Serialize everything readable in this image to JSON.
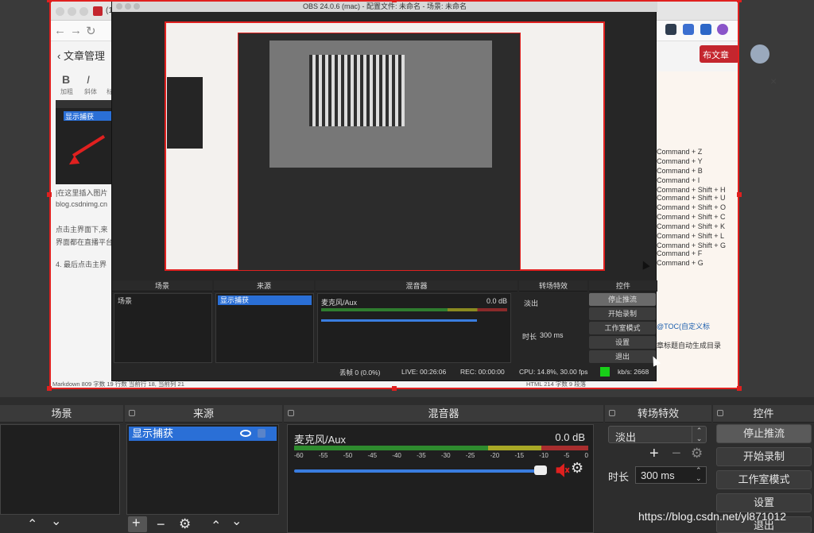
{
  "outer_browser": {
    "tab_title": "(1",
    "back_label": "文章管理",
    "toolbar": {
      "bold": "B",
      "italic": "I",
      "bold_sub": "加粗",
      "italic_sub": "斜体",
      "more_sub": "标"
    },
    "thumb_selected": "显示捕获",
    "left_text_lines": [
      "|在这里插入图片",
      "blog.csdnimg.cn",
      "点击主界面下,来",
      "界面都在直播平台",
      "4. 最后点击主界"
    ],
    "publish_button": "布文章",
    "close_label": "×",
    "right_lines": [
      "Command + Z",
      "Command + Y",
      "Command + B",
      "Command + I",
      "Command + Shift + H",
      "Command + Shift + U",
      "Command + Shift + O",
      "Command + Shift + C",
      "Command + Shift + K",
      "Command + Shift + L",
      "Command + Shift + G",
      "Command + F",
      "Command + G"
    ],
    "right_toc": "@TOC(自定义标",
    "right_toc2": "章标题自动生成目录",
    "statusbar_left": "Markdown  809 字数  19 行数  当前行 18, 当前列 21",
    "statusbar_right": "HTML  214 字数  9 段落"
  },
  "obs_window": {
    "title": "OBS 24.0.6 (mac) - 配置文件: 未命名 - 场景: 未命名",
    "mini": {
      "docks": [
        "场景",
        "来源",
        "混音器",
        "转场特效",
        "控件"
      ],
      "scene_item": "场景",
      "source_item": "显示捕获",
      "mixer_label": "麦克风/Aux",
      "mixer_db": "0.0 dB",
      "transition": "淡出",
      "duration_label": "时长",
      "duration_value": "300 ms",
      "controls": [
        "停止推流",
        "开始录制",
        "工作室模式",
        "设置",
        "退出"
      ],
      "status": {
        "dropped": "丢帧 0 (0.0%)",
        "live": "LIVE: 00:26:06",
        "rec": "REC: 00:00:00",
        "cpu": "CPU: 14.8%, 30.00 fps",
        "kbs": "kb/s: 2668"
      }
    }
  },
  "docks": {
    "scenes": {
      "title": "场景"
    },
    "sources": {
      "title": "来源",
      "item": "显示捕获"
    },
    "mixer": {
      "title": "混音器",
      "channel": "麦克风/Aux",
      "db": "0.0 dB",
      "ticks": [
        "-60",
        "-55",
        "-50",
        "-45",
        "-40",
        "-35",
        "-30",
        "-25",
        "-20",
        "-15",
        "-10",
        "-5",
        "0"
      ]
    },
    "transitions": {
      "title": "转场特效",
      "selected": "淡出",
      "duration_label": "时长",
      "duration_value": "300 ms"
    },
    "controls": {
      "title": "控件",
      "stop_stream": "停止推流",
      "start_record": "开始录制",
      "studio_mode": "工作室模式",
      "settings": "设置",
      "exit": "退出"
    }
  },
  "watermark": "https://blog.csdn.net/yl871012",
  "colors": {
    "accent": "#2a6fd6",
    "frame": "#e0201f",
    "publish": "#c4262e"
  }
}
